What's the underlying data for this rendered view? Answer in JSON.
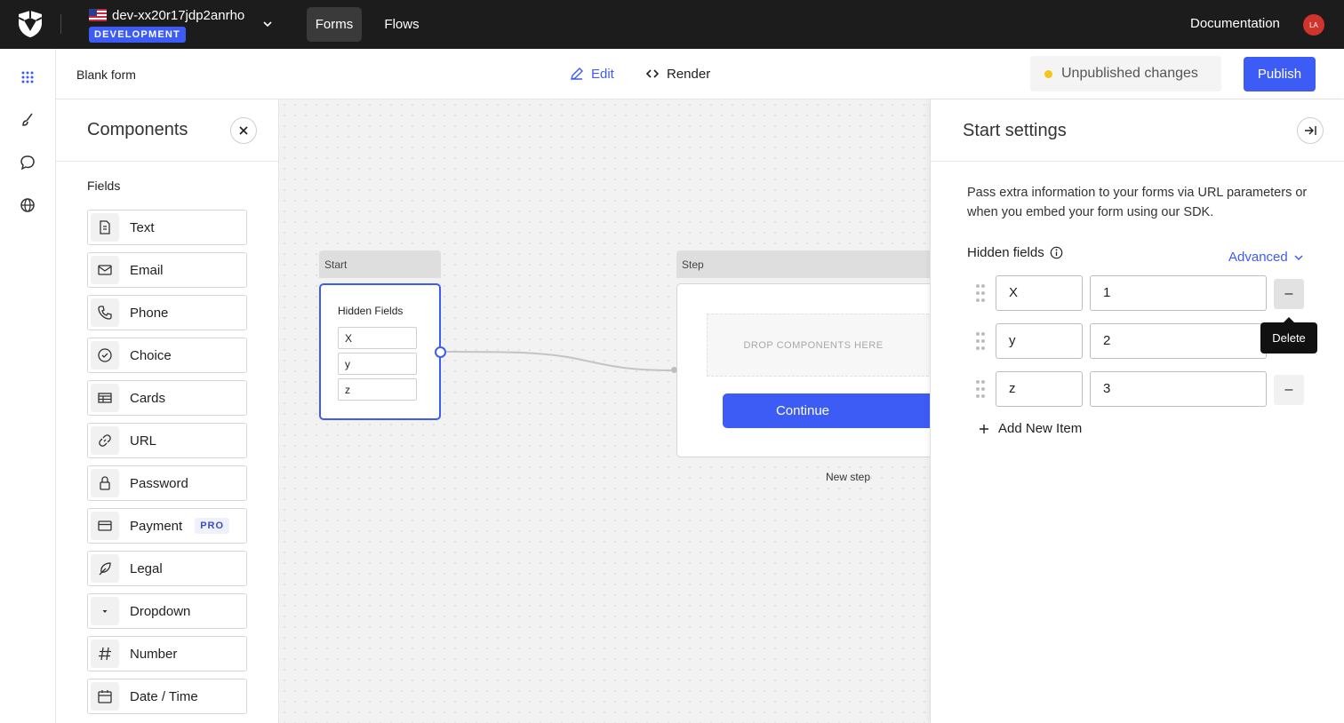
{
  "topbar": {
    "tenant_name": "dev-xx20r17jdp2anrho",
    "environment": "DEVELOPMENT",
    "nav": {
      "forms": "Forms",
      "flows": "Flows"
    },
    "documentation": "Documentation",
    "avatar_initials": "LA"
  },
  "subheader": {
    "form_title": "Blank form",
    "edit": "Edit",
    "render": "Render",
    "status": "Unpublished changes",
    "publish": "Publish"
  },
  "components": {
    "title": "Components",
    "section": "Fields",
    "items": [
      {
        "label": "Text",
        "icon": "document-icon"
      },
      {
        "label": "Email",
        "icon": "envelope-icon"
      },
      {
        "label": "Phone",
        "icon": "phone-icon"
      },
      {
        "label": "Choice",
        "icon": "check-circle-icon"
      },
      {
        "label": "Cards",
        "icon": "table-icon"
      },
      {
        "label": "URL",
        "icon": "link-icon"
      },
      {
        "label": "Password",
        "icon": "lock-icon"
      },
      {
        "label": "Payment",
        "icon": "credit-card-icon",
        "badge": "PRO"
      },
      {
        "label": "Legal",
        "icon": "feather-icon"
      },
      {
        "label": "Dropdown",
        "icon": "caret-down-icon"
      },
      {
        "label": "Number",
        "icon": "hash-icon"
      },
      {
        "label": "Date / Time",
        "icon": "calendar-icon"
      }
    ]
  },
  "canvas": {
    "start_node": {
      "header": "Start",
      "title": "Hidden Fields",
      "fields": [
        "X",
        "y",
        "z"
      ]
    },
    "step_node": {
      "header": "Step",
      "drop_text": "DROP COMPONENTS HERE",
      "button": "Continue",
      "caption": "New step"
    }
  },
  "settings": {
    "title": "Start settings",
    "description": "Pass extra information to your forms via URL parameters or when you embed your form using our SDK.",
    "hidden_fields_label": "Hidden fields",
    "advanced": "Advanced",
    "rows": [
      {
        "key": "X",
        "value": "1"
      },
      {
        "key": "y",
        "value": "2"
      },
      {
        "key": "z",
        "value": "3"
      }
    ],
    "delete_symbol": "–",
    "tooltip": "Delete",
    "add_item": "Add New Item"
  },
  "colors": {
    "accent": "#3d5cf5",
    "topbar": "#1c1c1c",
    "status_dot": "#f5c518",
    "avatar": "#d0342c"
  }
}
